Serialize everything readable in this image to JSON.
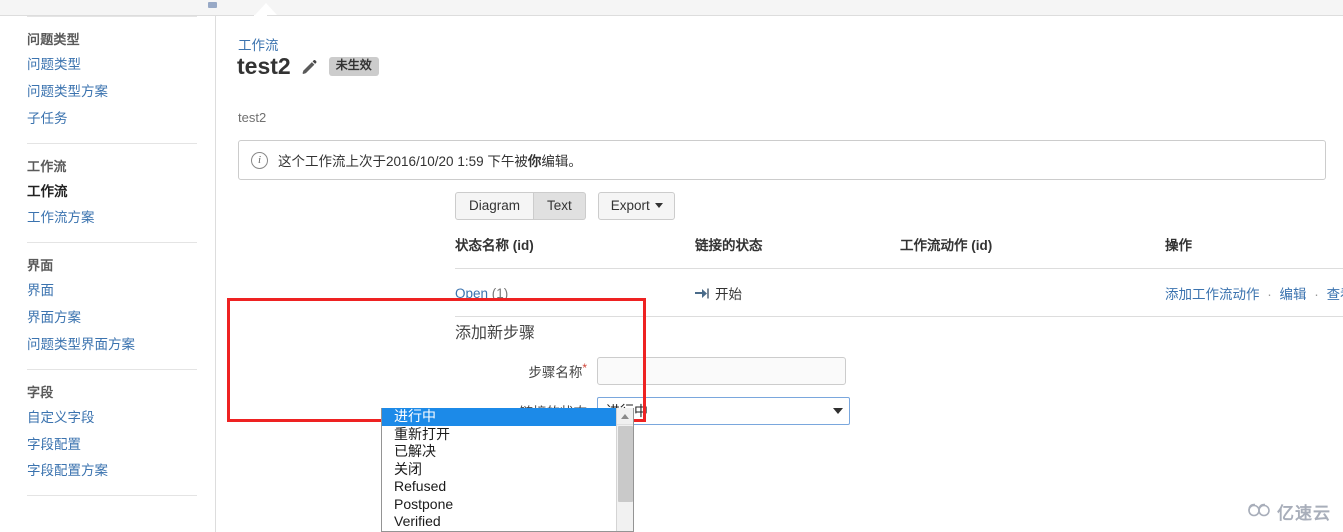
{
  "topbar": {
    "blue_dot": "blue-dot-marker"
  },
  "sidebar": {
    "groups": [
      {
        "heading": "问题类型",
        "items": [
          {
            "label": "问题类型",
            "current": false
          },
          {
            "label": "问题类型方案",
            "current": false
          },
          {
            "label": "子任务",
            "current": false
          }
        ]
      },
      {
        "heading": "工作流",
        "items": [
          {
            "label": "工作流",
            "current": true
          },
          {
            "label": "工作流方案",
            "current": false
          }
        ]
      },
      {
        "heading": "界面",
        "items": [
          {
            "label": "界面",
            "current": false
          },
          {
            "label": "界面方案",
            "current": false
          },
          {
            "label": "问题类型界面方案",
            "current": false
          }
        ]
      },
      {
        "heading": "字段",
        "items": [
          {
            "label": "自定义字段",
            "current": false
          },
          {
            "label": "字段配置",
            "current": false
          },
          {
            "label": "字段配置方案",
            "current": false
          }
        ]
      }
    ]
  },
  "main": {
    "breadcrumb": "工作流",
    "title": "test2",
    "edit_icon": "pencil-icon",
    "status_badge": "未生效",
    "description": "test2",
    "info_banner": {
      "icon": "info-icon",
      "text_prefix": "这个工作流上次于2016/10/20 1:59 下午被",
      "text_bold": "你",
      "text_suffix": "编辑。"
    },
    "toolbar": {
      "diagram_label": "Diagram",
      "text_label": "Text",
      "active_view": "Text",
      "export_label": "Export"
    },
    "table": {
      "columns": [
        "状态名称 (id)",
        "链接的状态",
        "工作流动作 (id)",
        "操作"
      ],
      "rows": [
        {
          "state_name": "Open",
          "state_id": "(1)",
          "linked_status_icon": "arrow-right-icon",
          "linked_status": "开始",
          "workflow_action": "",
          "actions": [
            "添加工作流动作",
            "编辑",
            "查看工作流属性"
          ],
          "action_separator": "·"
        }
      ]
    },
    "form": {
      "title": "添加新步骤",
      "step_name": {
        "label": "步骤名称",
        "required_marker": "*",
        "value": "",
        "placeholder": ""
      },
      "linked_status": {
        "label": "链接的状态",
        "selected": "进行中",
        "expanded": true,
        "options": [
          "进行中",
          "重新打开",
          "已解决",
          "关闭",
          "Refused",
          "Postpone",
          "Verified"
        ]
      }
    },
    "highlight_box_color": "#ee2222"
  },
  "watermark": {
    "text": "亿速云",
    "icon": "cloud-icon"
  }
}
